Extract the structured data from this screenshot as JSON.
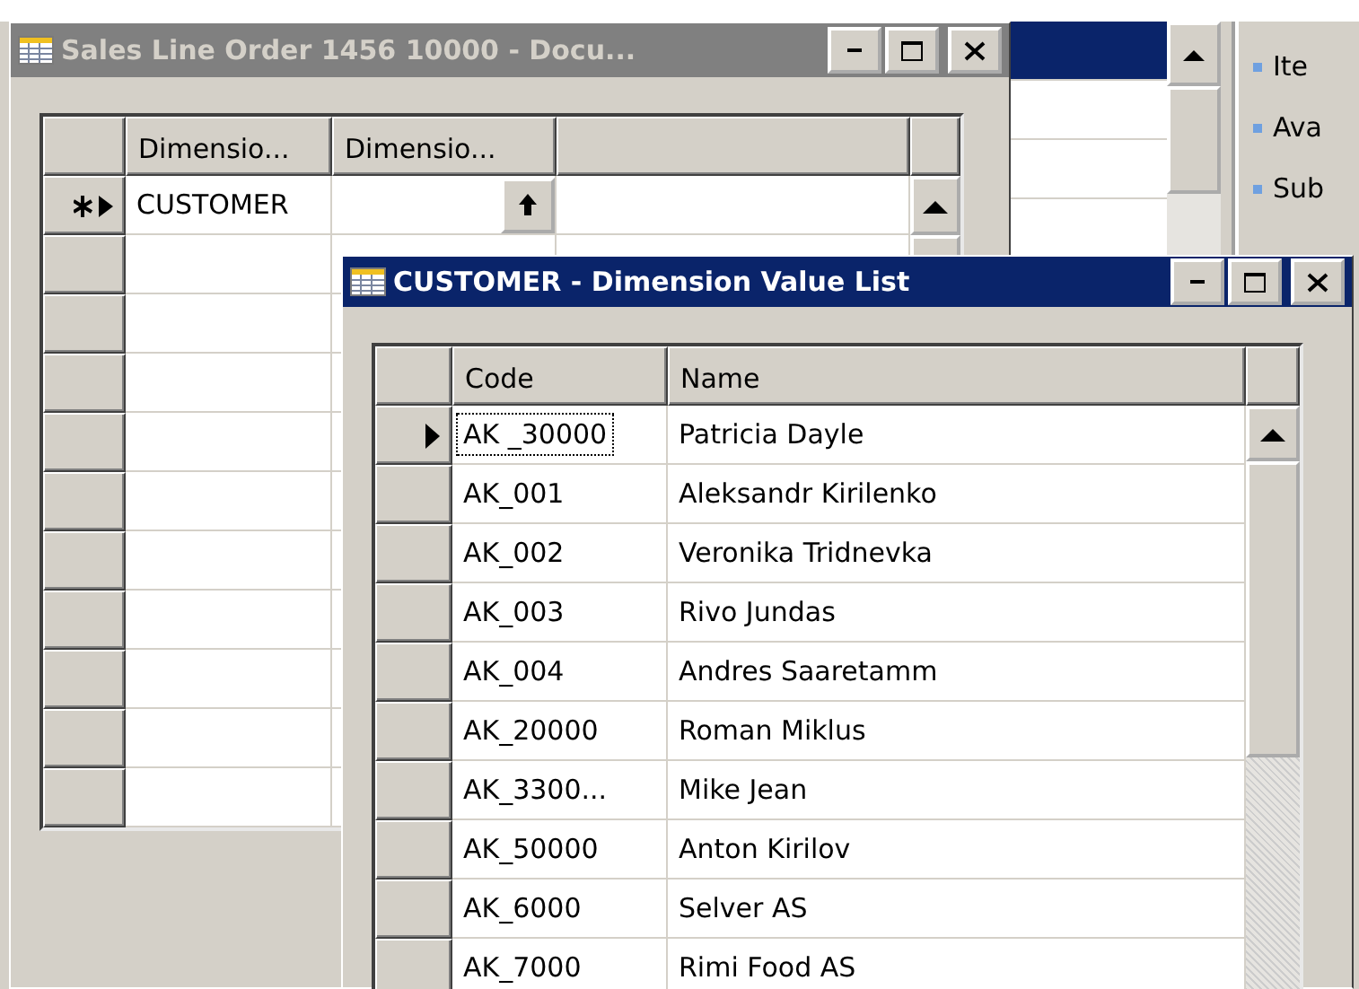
{
  "back_window": {
    "title": "Sales Line Order 1456 10000 - Docu...",
    "active": false,
    "columns": [
      "Dimensio...",
      "Dimensio...",
      ""
    ],
    "rows": [
      {
        "code": "CUSTOMER",
        "value": "",
        "new_record": true
      }
    ]
  },
  "side_links": [
    "Ite",
    "Ava",
    "Sub"
  ],
  "dialog": {
    "title": "CUSTOMER - Dimension Value List",
    "active": true,
    "columns": [
      "Code",
      "Name"
    ],
    "rows": [
      {
        "code": "AK _30000",
        "name": "Patricia Dayle",
        "selected": true
      },
      {
        "code": "AK_001",
        "name": "Aleksandr Kirilenko",
        "selected": false
      },
      {
        "code": "AK_002",
        "name": "Veronika Tridnevka",
        "selected": false
      },
      {
        "code": "AK_003",
        "name": "Rivo Jundas",
        "selected": false
      },
      {
        "code": "AK_004",
        "name": "Andres Saaretamm",
        "selected": false
      },
      {
        "code": "AK_20000",
        "name": "Roman Miklus",
        "selected": false
      },
      {
        "code": "AK_3300...",
        "name": "Mike Jean",
        "selected": false
      },
      {
        "code": "AK_50000",
        "name": "Anton Kirilov",
        "selected": false
      },
      {
        "code": "AK_6000",
        "name": "Selver AS",
        "selected": false
      },
      {
        "code": "AK_7000",
        "name": "Rimi Food AS",
        "selected": false
      }
    ]
  }
}
